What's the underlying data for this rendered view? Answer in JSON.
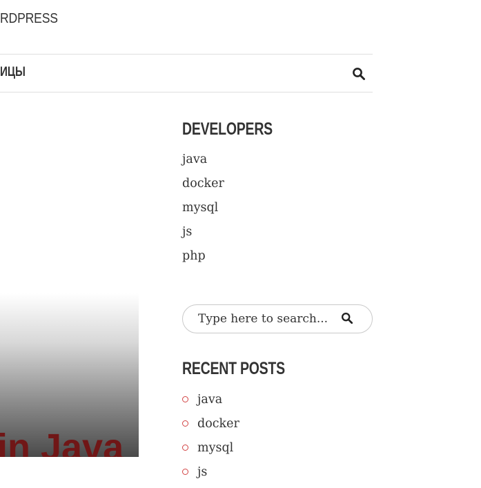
{
  "site": {
    "title": "RDPRESS"
  },
  "nav": {
    "item": "ИЦЫ",
    "search_icon": "search-icon"
  },
  "developers": {
    "title": "DEVELOPERS",
    "items": [
      "java",
      "docker",
      "mysql",
      "js",
      "php"
    ]
  },
  "search": {
    "placeholder": "Type here to search...",
    "icon": "search-icon"
  },
  "recent_posts": {
    "title": "RECENT POSTS",
    "items": [
      "java",
      "docker",
      "mysql",
      "js"
    ]
  },
  "featured": {
    "thumbnail_text": "in Java"
  },
  "colors": {
    "accent": "#d24343",
    "text": "#333333",
    "border": "#dedede",
    "thumb_text": "#701616"
  }
}
